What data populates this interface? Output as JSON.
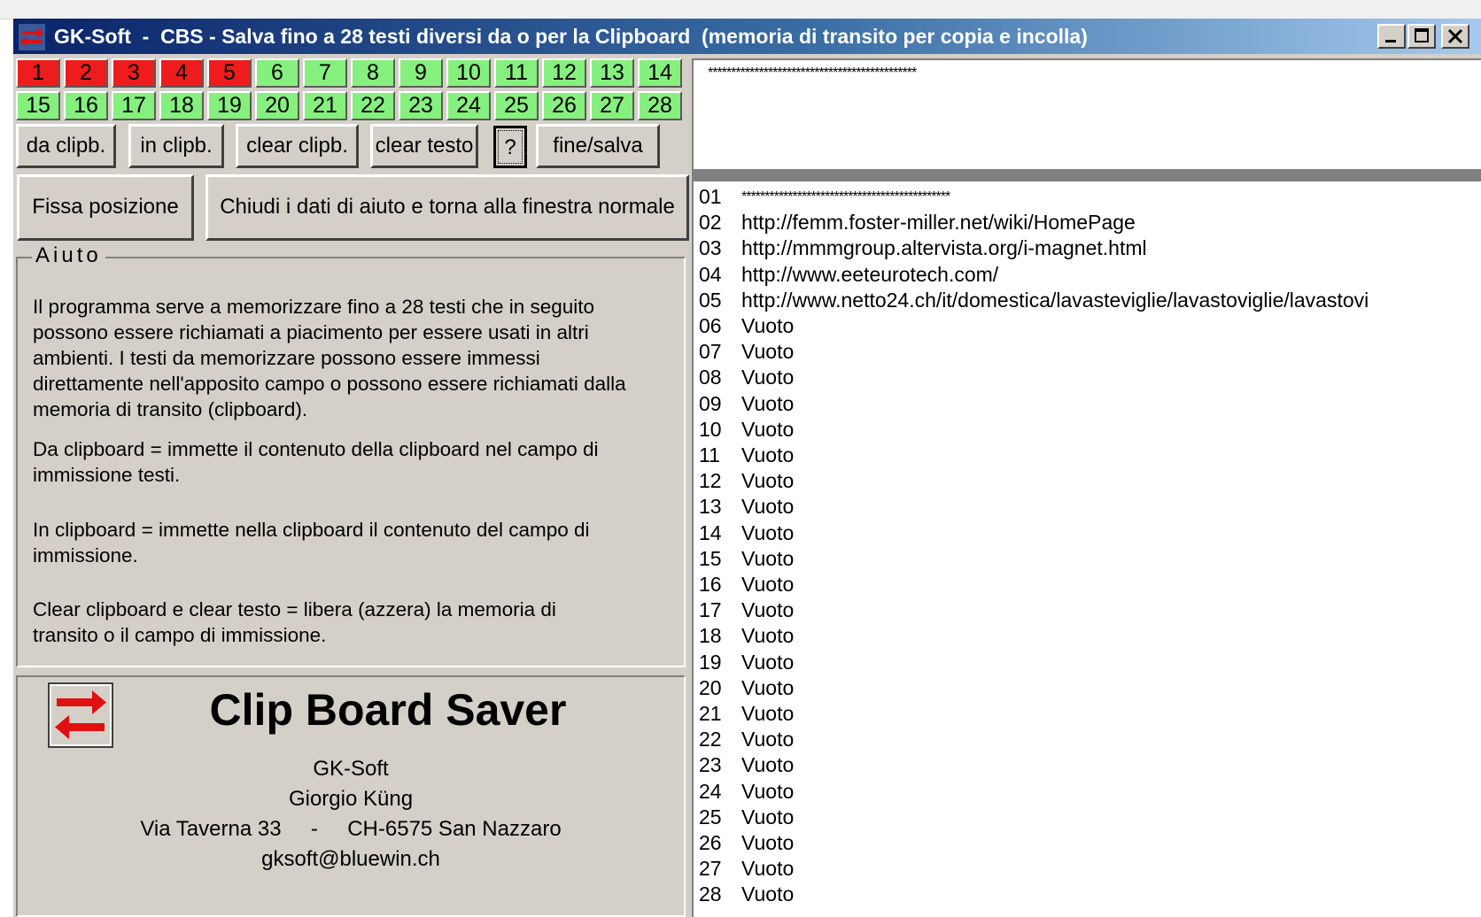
{
  "window": {
    "title": "GK-Soft  -  CBS - Salva fino a 28 testi diversi da o per la Clipboard  (memoria di transito per copia e incolla)",
    "icons": {
      "app": "double-arrow-icon",
      "min": "minimize-icon",
      "max": "maximize-icon",
      "close": "close-icon"
    }
  },
  "slots": {
    "row1": [
      "1",
      "2",
      "3",
      "4",
      "5",
      "6",
      "7",
      "8",
      "9",
      "10",
      "11",
      "12",
      "13",
      "14"
    ],
    "row2": [
      "15",
      "16",
      "17",
      "18",
      "19",
      "20",
      "21",
      "22",
      "23",
      "24",
      "25",
      "26",
      "27",
      "28"
    ],
    "filled": [
      "1",
      "2",
      "3",
      "4",
      "5"
    ],
    "colors": {
      "filled": "#ee1c1c",
      "empty": "#86f07e"
    }
  },
  "toolbar": {
    "da_clipb": "da clipb.",
    "in_clipb": "in clipb.",
    "clear_clipb": "clear clipb.",
    "clear_testo": "clear testo",
    "help": "?",
    "fine_salva": "fine/salva"
  },
  "input": {
    "value": "*********************************************"
  },
  "actions": {
    "fissa": "Fissa posizione",
    "chiudi": "Chiudi i dati di aiuto e torna alla finestra normale"
  },
  "help": {
    "legend": "Aiuto",
    "lines": [
      "Il programma serve a memorizzare fino a 28 testi che in seguito",
      "possono essere richiamati a piacimento per essere usati in altri",
      "ambienti. I testi da memorizzare possono essere immessi",
      "direttamente nell'apposito campo o possono essere richiamati dalla",
      "memoria di transito (clipboard).",
      "Da clipboard  =  immette il contenuto della clipboard nel campo di",
      "immissione testi.",
      "In clipboard  =  immette nella clipboard il contenuto del campo di",
      "immissione.",
      "Clear clipboard    e    clear testo   =   libera (azzera) la memoria di",
      "transito o il campo di immissione."
    ]
  },
  "about": {
    "title": "Clip Board Saver",
    "company": "GK-Soft",
    "author": "Giorgio Küng",
    "address": "Via Taverna 33     -     CH-6575 San Nazzaro",
    "email": "gksoft@bluewin.ch"
  },
  "list": [
    {
      "num": "01",
      "text": "*********************************************"
    },
    {
      "num": "02",
      "text": "http://femm.foster-miller.net/wiki/HomePage"
    },
    {
      "num": "03",
      "text": "http://mmmgroup.altervista.org/i-magnet.html"
    },
    {
      "num": "04",
      "text": "http://www.eeteurotech.com/"
    },
    {
      "num": "05",
      "text": "http://www.netto24.ch/it/domestica/lavasteviglie/lavastoviglie/lavastovi"
    },
    {
      "num": "06",
      "text": "Vuoto"
    },
    {
      "num": "07",
      "text": "Vuoto"
    },
    {
      "num": "08",
      "text": "Vuoto"
    },
    {
      "num": "09",
      "text": "Vuoto"
    },
    {
      "num": "10",
      "text": "Vuoto"
    },
    {
      "num": "11",
      "text": "Vuoto"
    },
    {
      "num": "12",
      "text": "Vuoto"
    },
    {
      "num": "13",
      "text": "Vuoto"
    },
    {
      "num": "14",
      "text": "Vuoto"
    },
    {
      "num": "15",
      "text": "Vuoto"
    },
    {
      "num": "16",
      "text": "Vuoto"
    },
    {
      "num": "17",
      "text": "Vuoto"
    },
    {
      "num": "18",
      "text": "Vuoto"
    },
    {
      "num": "19",
      "text": "Vuoto"
    },
    {
      "num": "20",
      "text": "Vuoto"
    },
    {
      "num": "21",
      "text": "Vuoto"
    },
    {
      "num": "22",
      "text": "Vuoto"
    },
    {
      "num": "23",
      "text": "Vuoto"
    },
    {
      "num": "24",
      "text": "Vuoto"
    },
    {
      "num": "25",
      "text": "Vuoto"
    },
    {
      "num": "26",
      "text": "Vuoto"
    },
    {
      "num": "27",
      "text": "Vuoto"
    },
    {
      "num": "28",
      "text": "Vuoto"
    }
  ]
}
